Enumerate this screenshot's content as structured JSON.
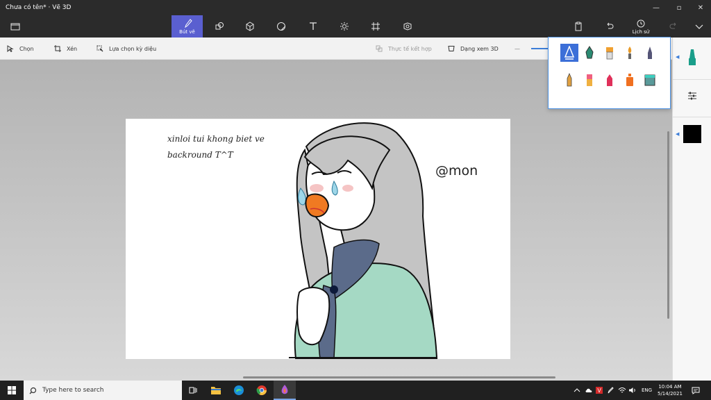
{
  "window": {
    "title": "Chưa có tên*  ·  Vẽ 3D"
  },
  "toolbar": {
    "active_tab_label": "Bút vẽ",
    "history_label": "Lịch sử",
    "tabs": [
      "brushes-icon",
      "shapes-2d-icon",
      "shapes-3d-icon",
      "stickers-icon",
      "text-icon",
      "effects-icon",
      "canvas-icon",
      "library-3d-icon"
    ]
  },
  "subbar": {
    "select": "Chọn",
    "crop": "Xén",
    "magic_select": "Lựa chọn kỳ diệu",
    "mixed_reality": "Thực tế kết hợp",
    "view_3d": "Dạng xem 3D"
  },
  "canvas": {
    "note_line1": "xinloi tui khong biet ve",
    "note_line2": "backround T^T",
    "signature": "@mon"
  },
  "panel": {
    "color_current": "#000000",
    "marker_color": "#1a9e8a"
  },
  "flyout": {
    "brushes": [
      {
        "name": "calligraphy-pen-icon",
        "color": "#ffffff"
      },
      {
        "name": "ink-pen-icon",
        "color": "#2a8a72"
      },
      {
        "name": "oil-brush-icon",
        "color": "#f0a030"
      },
      {
        "name": "watercolor-icon",
        "color": "#e89a28"
      },
      {
        "name": "pixel-pen-icon",
        "color": "#555577"
      },
      {
        "name": "pencil-icon",
        "color": "#e0a040"
      },
      {
        "name": "eraser-icon",
        "color": "#f06080"
      },
      {
        "name": "crayon-icon",
        "color": "#e0305a"
      },
      {
        "name": "spray-can-icon",
        "color": "#f07020"
      },
      {
        "name": "fill-icon",
        "color": "#5a9a9a"
      }
    ]
  },
  "taskbar": {
    "search_placeholder": "Type here to search",
    "lang": "ENG",
    "time": "10:04 AM",
    "date": "5/14/2021"
  }
}
